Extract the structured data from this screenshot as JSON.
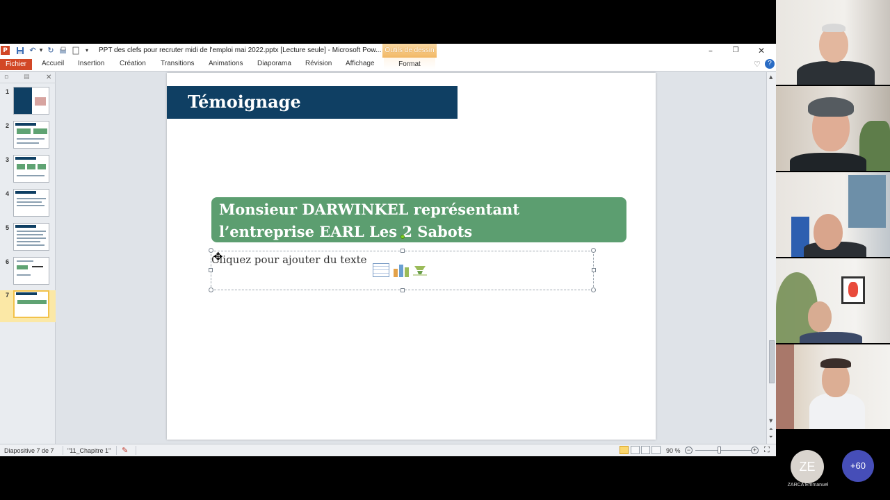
{
  "window": {
    "title": "PPT des clefs pour recruter midi de l'emploi mai 2022.pptx [Lecture seule]  -  Microsoft Pow...",
    "context_tab": "Outils de dessin",
    "minimize": "–",
    "restore": "❐",
    "close": "✕"
  },
  "ribbon": {
    "tabs": [
      "Fichier",
      "Accueil",
      "Insertion",
      "Création",
      "Transitions",
      "Animations",
      "Diaporama",
      "Révision",
      "Affichage",
      "Format"
    ],
    "help": "?"
  },
  "thumbnails": {
    "numbers": [
      "1",
      "2",
      "3",
      "4",
      "5",
      "6",
      "7"
    ],
    "active_index": 7
  },
  "slide": {
    "title": "Témoignage",
    "green_box_line1": "Monsieur DARWINKEL représentant",
    "green_box_line2": "l’entreprise EARL Les 2 Sabots",
    "placeholder_text": "Cliquez pour ajouter du texte"
  },
  "statusbar": {
    "slide_info": "Diapositive 7 de 7",
    "theme": "\"11_Chapitre 1\"",
    "zoom": "90 %"
  },
  "call": {
    "participant_initials": "ZE",
    "participant_name": "ZARCA Emmanuel",
    "more_count": "+60"
  },
  "colors": {
    "title_bar": "#0f3f63",
    "green_box": "#5c9e70",
    "file_tab": "#d24726",
    "more_badge": "#464eb8"
  }
}
